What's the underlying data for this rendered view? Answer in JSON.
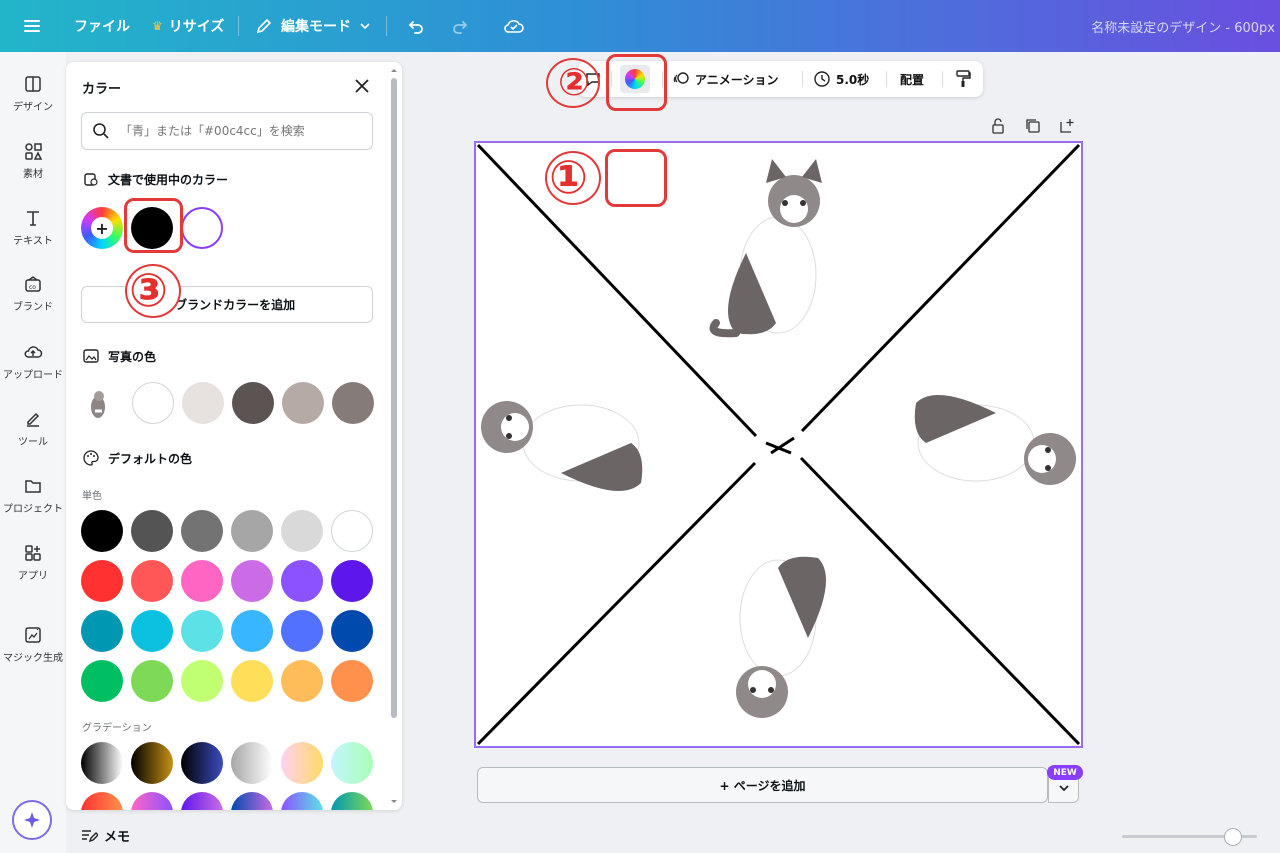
{
  "topbar": {
    "file": "ファイル",
    "resize": "リサイズ",
    "edit_mode": "編集モード",
    "doc_title": "名称未設定のデザイン - 600px ×"
  },
  "rail": {
    "items": [
      {
        "label": "デザイン",
        "icon": "design-icon"
      },
      {
        "label": "素材",
        "icon": "elements-icon"
      },
      {
        "label": "テキスト",
        "icon": "text-icon"
      },
      {
        "label": "ブランド",
        "icon": "brand-icon"
      },
      {
        "label": "アップロード",
        "icon": "upload-icon"
      },
      {
        "label": "ツール",
        "icon": "tools-icon"
      },
      {
        "label": "プロジェクト",
        "icon": "folder-icon"
      },
      {
        "label": "アプリ",
        "icon": "apps-icon"
      },
      {
        "label": "マジック生成",
        "icon": "magic-media-icon"
      }
    ]
  },
  "panel": {
    "title": "カラー",
    "search_placeholder": "「青」または「#00c4cc」を検索",
    "doc_colors_title": "文書で使用中のカラー",
    "doc_colors": [
      "#000000",
      "#ffffff"
    ],
    "add_brand": "＋ ブランドカラーを追加",
    "photo_colors_title": "写真の色",
    "photo_colors": [
      "#ffffff",
      "#e7e1df",
      "#5c5453",
      "#b6aaa7",
      "#857c7a"
    ],
    "default_title": "デフォルトの色",
    "solid_label": "単色",
    "solid_colors": [
      "#000000",
      "#545454",
      "#737373",
      "#a6a6a6",
      "#d9d9d9",
      "#ffffff",
      "#ff3131",
      "#ff5757",
      "#ff66c4",
      "#cb6ce6",
      "#8c52ff",
      "#5e17eb",
      "#0097b2",
      "#0cc0df",
      "#5ce1e6",
      "#38b6ff",
      "#5271ff",
      "#004aad",
      "#00bf63",
      "#7ed957",
      "#c1ff72",
      "#ffde59",
      "#ffbd59",
      "#ff914d"
    ],
    "gradient_label": "グラデーション",
    "gradient_colors": [
      [
        "#000000",
        "#ffffff"
      ],
      [
        "#000000",
        "#c89116"
      ],
      [
        "#000000",
        "#3b4cc0"
      ],
      [
        "#a6a6a6",
        "#ffffff"
      ],
      [
        "#ffd1f3",
        "#ffd967"
      ],
      [
        "#c5f5ff",
        "#a7ffb3"
      ]
    ]
  },
  "ctx_toolbar": {
    "animation": "アニメーション",
    "duration": "5.0秒",
    "position": "配置"
  },
  "canvas": {
    "add_page": "+ ページを追加",
    "new_badge": "NEW"
  },
  "footer": {
    "memo": "メモ"
  },
  "annotations": {
    "one": "①",
    "two": "②",
    "three": "③"
  }
}
